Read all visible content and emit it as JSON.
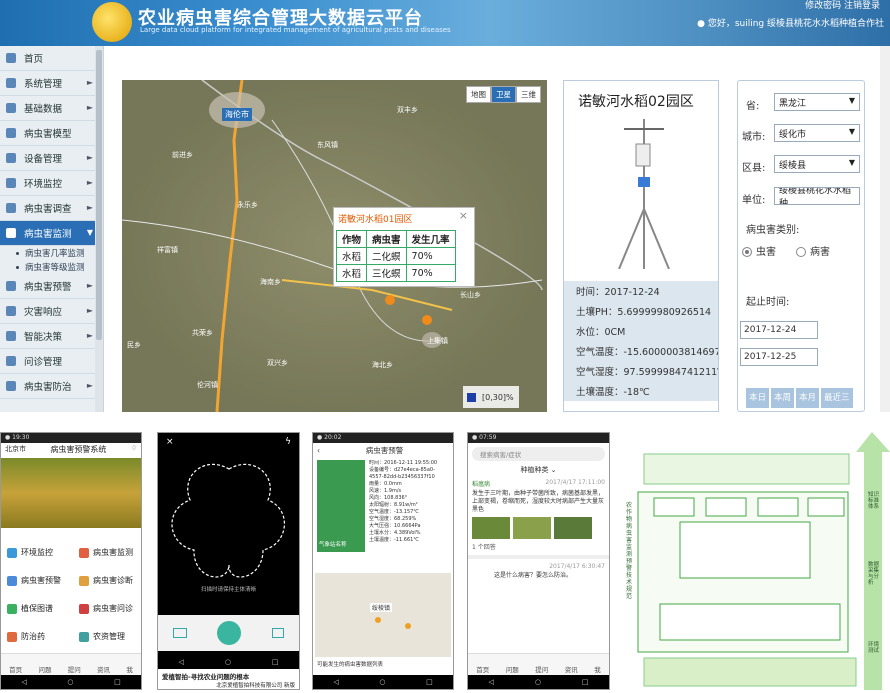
{
  "app": {
    "title": "农业病虫害综合管理大数据云平台",
    "subtitle": "Large data cloud platform for integrated management of agricultural pests and diseases",
    "top_links": "修改密码   注销登录",
    "user_greeting": "您好，suiling   绥棱县桃花水水稻种植合作社"
  },
  "sidebar": {
    "items": [
      {
        "label": "首页"
      },
      {
        "label": "系统管理"
      },
      {
        "label": "基础数据"
      },
      {
        "label": "病虫害模型"
      },
      {
        "label": "设备管理"
      },
      {
        "label": "环境监控"
      },
      {
        "label": "病虫害调查"
      },
      {
        "label": "病虫害监测"
      },
      {
        "label": "病虫害预警"
      },
      {
        "label": "灾害响应"
      },
      {
        "label": "智能决策"
      },
      {
        "label": "问诊管理"
      },
      {
        "label": "病虫害防治"
      }
    ],
    "subitems": [
      "病虫害几率监测",
      "病虫害等级监测"
    ]
  },
  "map": {
    "tabs": [
      "地图",
      "卫星",
      "三维"
    ],
    "places": [
      "海伦市",
      "东风镇",
      "双丰乡",
      "前进乡",
      "永乐乡",
      "祥富镇",
      "海南乡",
      "长山乡",
      "共荣乡",
      "上集镇",
      "双兴乡",
      "海北乡",
      "民乡",
      "伦河镇"
    ],
    "popup": {
      "title": "诺敏河水稻01园区",
      "headers": [
        "作物",
        "病虫害",
        "发生几率"
      ],
      "rows": [
        [
          "水稻",
          "二化螟",
          "70%"
        ],
        [
          "水稻",
          "三化螟",
          "70%"
        ]
      ]
    },
    "legend": "[0,30]%"
  },
  "station": {
    "name": "诺敏河水稻02园区",
    "readings": [
      "时间：2017-12-24",
      "土壤PH：5.69999980926514",
      "水位：0CM",
      "空气温度：-15.6000003814697℃",
      "空气湿度：97.5999984741211Vol",
      "土壤温度：-18℃"
    ]
  },
  "filters": {
    "province_label": "省:",
    "province": "黑龙江",
    "city_label": "城市:",
    "city": "绥化市",
    "county_label": "区县:",
    "county": "绥棱县",
    "unit_label": "单位:",
    "unit": "绥棱县桃花水水稻种",
    "category_label": "病虫害类别:",
    "cat_pest": "虫害",
    "cat_disease": "病害",
    "date_label": "起止时间:",
    "date_from": "2017-12-24",
    "date_to": "2017-12-25",
    "quick": [
      "本日",
      "本周",
      "本月",
      "最近三"
    ]
  },
  "phone1": {
    "status": "北京市",
    "title": "病虫害预警系统",
    "menu": [
      "环境监控",
      "病虫害监测",
      "病虫害预警",
      "病虫害诊断",
      "植保图谱",
      "病虫害问诊",
      "防治药",
      "农资管理"
    ],
    "tabs": [
      "首页",
      "问题",
      "提问",
      "资讯",
      "我"
    ]
  },
  "phone2": {
    "hint": "扫描时请保持主体清晰",
    "footer": "爱植智拍-寻找农业问题的根本",
    "footer2": "北京爱植智拍科技有限公司 新版"
  },
  "phone3": {
    "title": "病虫害预警",
    "site": "气象站名称",
    "data": [
      "时间：2016-12-11 19:55:00",
      "设备编号：d27e4eca-85a0-4557-82dd-b23456337f10",
      "雨量：0.0mm",
      "风速：1.9m/s",
      "风向：108.836°",
      "太阳辐射：8.91w/m²",
      "空气温度：-13.157℃",
      "空气湿度：68.259%",
      "大气压强：10.6664Pa",
      "土壤水分：4.389Vol%",
      "土壤温度：-11.661℃"
    ],
    "map_label": "绥棱镇",
    "footer": "可能发生的病虫害数据列表"
  },
  "phone4": {
    "search": "搜索病害/症状",
    "filter": "种植种类",
    "post1_user": "稻瘟病",
    "post1_time": "2017/4/17 17:11:00",
    "post1_text": "发生于三叶期，由种子带菌所致，病菌基部发黑，上部变褐，卷缩而死，湿度较大时病部产生大量灰黑色",
    "answers": "1 个回答",
    "post2_time": "2017/4/17 6:30:47",
    "post2_text": "这是什么病害？要怎么防治。",
    "tabs": [
      "首页",
      "问题",
      "提问",
      "资讯",
      "我"
    ]
  },
  "diagram": {
    "label": "农作物病虫害监测预警技术规范",
    "arrow_up": "知识标准体系",
    "arrow_right": "数据采集与分析",
    "arrow_bottom": "环境测试"
  }
}
